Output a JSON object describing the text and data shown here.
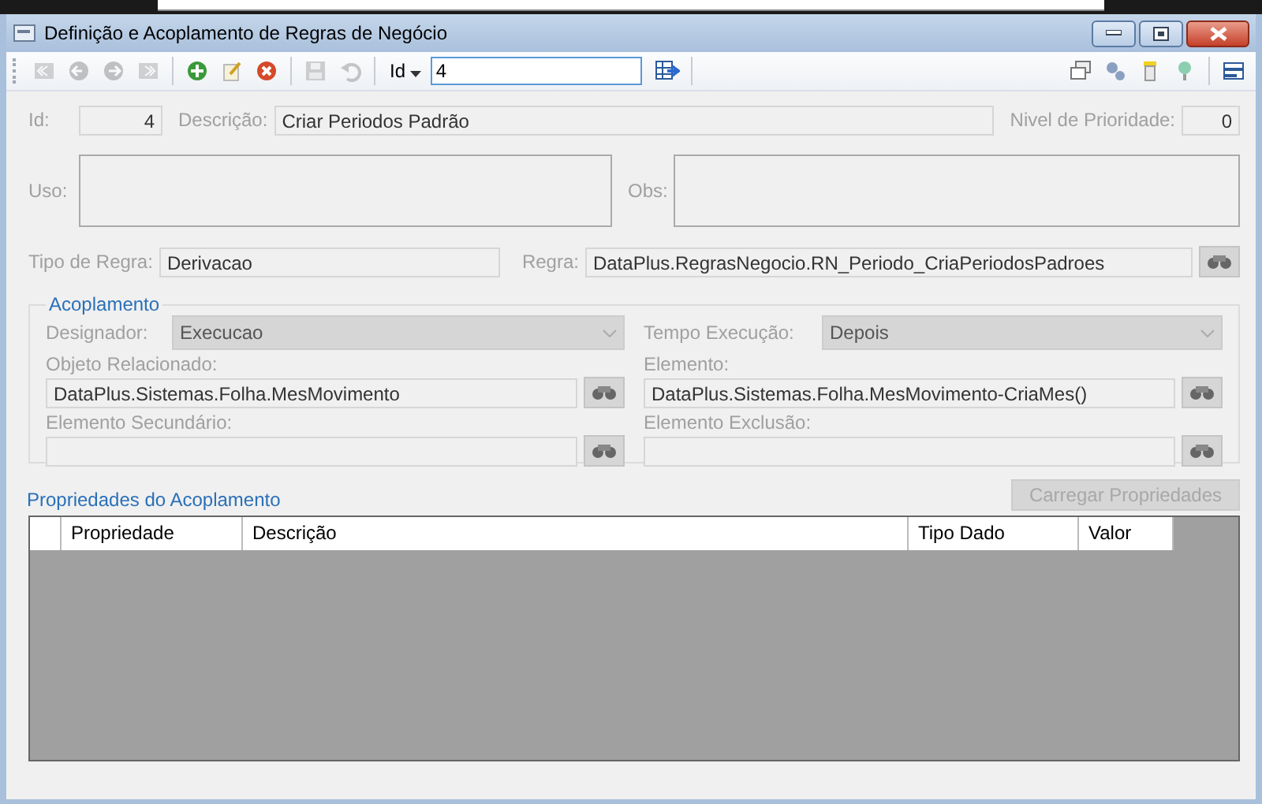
{
  "window": {
    "title": "Definição e Acoplamento de Regras de Negócio"
  },
  "toolbar": {
    "buttons": [
      {
        "kind": "first",
        "disabled": true
      },
      {
        "kind": "prev",
        "disabled": true
      },
      {
        "kind": "next",
        "disabled": true
      },
      {
        "kind": "last",
        "disabled": true
      },
      {
        "kind": "sep"
      },
      {
        "kind": "add",
        "disabled": false
      },
      {
        "kind": "edit",
        "disabled": false
      },
      {
        "kind": "delete",
        "disabled": false
      },
      {
        "kind": "sep"
      },
      {
        "kind": "save",
        "disabled": true
      },
      {
        "kind": "undo",
        "disabled": true
      }
    ],
    "search_field_label": "Id",
    "search_value": "4",
    "right_buttons": [
      {
        "kind": "cards"
      },
      {
        "kind": "keys"
      },
      {
        "kind": "filter"
      },
      {
        "kind": "pin"
      },
      {
        "kind": "sep"
      },
      {
        "kind": "panel"
      }
    ]
  },
  "form": {
    "id_label": "Id:",
    "id_value": "4",
    "descricao_label": "Descrição:",
    "descricao_value": "Criar Periodos Padrão",
    "prioridade_label": "Nivel de Prioridade:",
    "prioridade_value": "0",
    "uso_label": "Uso:",
    "obs_label": "Obs:",
    "tipo_label": "Tipo de Regra:",
    "tipo_value": "Derivacao",
    "regra_label": "Regra:",
    "regra_value": "DataPlus.RegrasNegocio.RN_Periodo_CriaPeriodosPadroes"
  },
  "acoplamento": {
    "title": "Acoplamento",
    "designador_label": "Designador:",
    "designador_value": "Execucao",
    "tempo_label": "Tempo Execução:",
    "tempo_value": "Depois",
    "fields": [
      {
        "label": "Objeto Relacionado:",
        "value": "DataPlus.Sistemas.Folha.MesMovimento"
      },
      {
        "label": "Elemento:",
        "value": "DataPlus.Sistemas.Folha.MesMovimento-CriaMes()"
      },
      {
        "label": "Elemento Secundário:"
      },
      {
        "label": "Elemento Exclusão:"
      }
    ]
  },
  "propriedades": {
    "title": "Propriedades do Acoplamento",
    "load_button": {
      "label": "Carregar Propriedades",
      "disabled": true
    },
    "columns": [
      "Propriedade",
      "Descrição",
      "Tipo Dado",
      "Valor"
    ]
  }
}
